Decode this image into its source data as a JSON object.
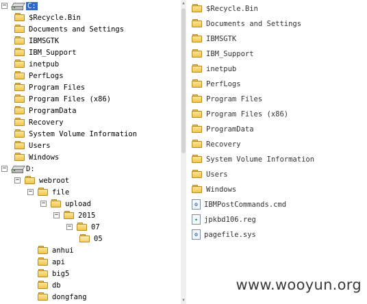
{
  "tree": {
    "nodes": [
      {
        "label": "C:",
        "kind": "drive",
        "expander": "-",
        "level": 0,
        "selected": true
      },
      {
        "label": "$Recycle.Bin",
        "kind": "folder",
        "level": 1
      },
      {
        "label": "Documents and Settings",
        "kind": "folder",
        "level": 1
      },
      {
        "label": "IBMSGTK",
        "kind": "folder",
        "level": 1
      },
      {
        "label": "IBM_Support",
        "kind": "folder",
        "level": 1
      },
      {
        "label": "inetpub",
        "kind": "folder",
        "level": 1
      },
      {
        "label": "PerfLogs",
        "kind": "folder",
        "level": 1
      },
      {
        "label": "Program Files",
        "kind": "folder",
        "level": 1
      },
      {
        "label": "Program Files (x86)",
        "kind": "folder",
        "level": 1
      },
      {
        "label": "ProgramData",
        "kind": "folder",
        "level": 1
      },
      {
        "label": "Recovery",
        "kind": "folder",
        "level": 1
      },
      {
        "label": "System Volume Information",
        "kind": "folder",
        "level": 1
      },
      {
        "label": "Users",
        "kind": "folder",
        "level": 1
      },
      {
        "label": "Windows",
        "kind": "folder",
        "level": 1
      },
      {
        "label": "D:",
        "kind": "drive",
        "expander": "-",
        "level": 0
      },
      {
        "label": "webroot",
        "kind": "folder",
        "expander": "-",
        "level": 1
      },
      {
        "label": "file",
        "kind": "folder",
        "expander": "-",
        "level": 2
      },
      {
        "label": "upload",
        "kind": "folder",
        "expander": "-",
        "level": 3
      },
      {
        "label": "2015",
        "kind": "folder",
        "expander": "-",
        "level": 4
      },
      {
        "label": "07",
        "kind": "folder",
        "expander": "-",
        "level": 5
      },
      {
        "label": "05",
        "kind": "folder-open",
        "level": 6
      },
      {
        "label": "anhui",
        "kind": "folder",
        "level": 2
      },
      {
        "label": "api",
        "kind": "folder",
        "level": 2
      },
      {
        "label": "big5",
        "kind": "folder",
        "level": 2
      },
      {
        "label": "db",
        "kind": "folder",
        "level": 2
      },
      {
        "label": "dongfang",
        "kind": "folder",
        "level": 2
      }
    ]
  },
  "list": {
    "items": [
      {
        "label": "$Recycle.Bin",
        "kind": "folder"
      },
      {
        "label": "Documents and Settings",
        "kind": "folder"
      },
      {
        "label": "IBMSGTK",
        "kind": "folder"
      },
      {
        "label": "IBM_Support",
        "kind": "folder"
      },
      {
        "label": "inetpub",
        "kind": "folder"
      },
      {
        "label": "PerfLogs",
        "kind": "folder"
      },
      {
        "label": "Program Files",
        "kind": "folder"
      },
      {
        "label": "Program Files (x86)",
        "kind": "folder"
      },
      {
        "label": "ProgramData",
        "kind": "folder"
      },
      {
        "label": "Recovery",
        "kind": "folder"
      },
      {
        "label": "System Volume Information",
        "kind": "folder"
      },
      {
        "label": "Users",
        "kind": "folder"
      },
      {
        "label": "Windows",
        "kind": "folder"
      },
      {
        "label": "IBMPostCommands.cmd",
        "kind": "file-cmd"
      },
      {
        "label": "jpkbd106.reg",
        "kind": "file-reg"
      },
      {
        "label": "pagefile.sys",
        "kind": "file-sys"
      }
    ]
  },
  "watermark": "www.wooyun.org",
  "colors": {
    "selection": "#3169c6",
    "folder": "#f1c64b"
  }
}
